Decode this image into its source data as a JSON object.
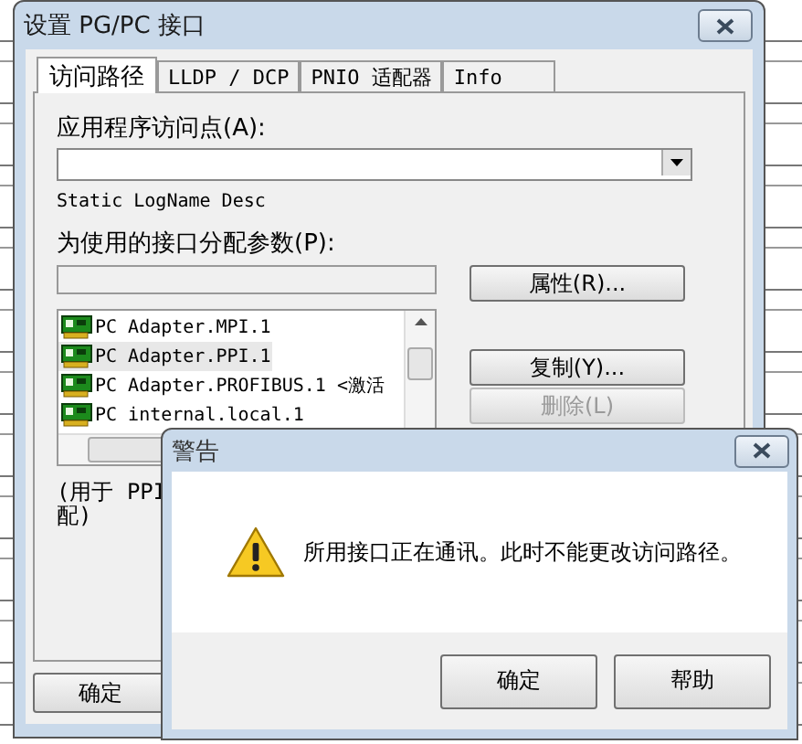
{
  "window": {
    "title": "设置 PG/PC 接口"
  },
  "tabs": [
    {
      "label": "访问路径",
      "selected": true
    },
    {
      "label": "LLDP / DCP",
      "selected": false
    },
    {
      "label": "PNIO 适配器",
      "selected": false
    },
    {
      "label": "Info",
      "selected": false
    }
  ],
  "access_point": {
    "label": "应用程序访问点(A):"
  },
  "description": "Static LogName Desc",
  "interface_params": {
    "label": "为使用的接口分配参数(P):"
  },
  "interfaces": [
    {
      "name": "PC Adapter.MPI.1",
      "selected": false
    },
    {
      "name": "PC Adapter.PPI.1",
      "selected": true
    },
    {
      "name": "PC Adapter.PROFIBUS.1",
      "status": "<激活",
      "selected": false
    },
    {
      "name": "PC internal.local.1",
      "selected": false
    }
  ],
  "side_buttons": [
    {
      "label": "属性(R)...",
      "disabled": false
    },
    {
      "label": "复制(Y)...",
      "disabled": false
    },
    {
      "label": "删除(L)",
      "disabled": true
    }
  ],
  "note_lines": [
    "(用于 PPI",
    "配)"
  ],
  "ok_button": "确定",
  "alert": {
    "title": "警告",
    "message": "所用接口正在通讯。此时不能更改访问路径。",
    "buttons": [
      "确定",
      "帮助"
    ]
  }
}
